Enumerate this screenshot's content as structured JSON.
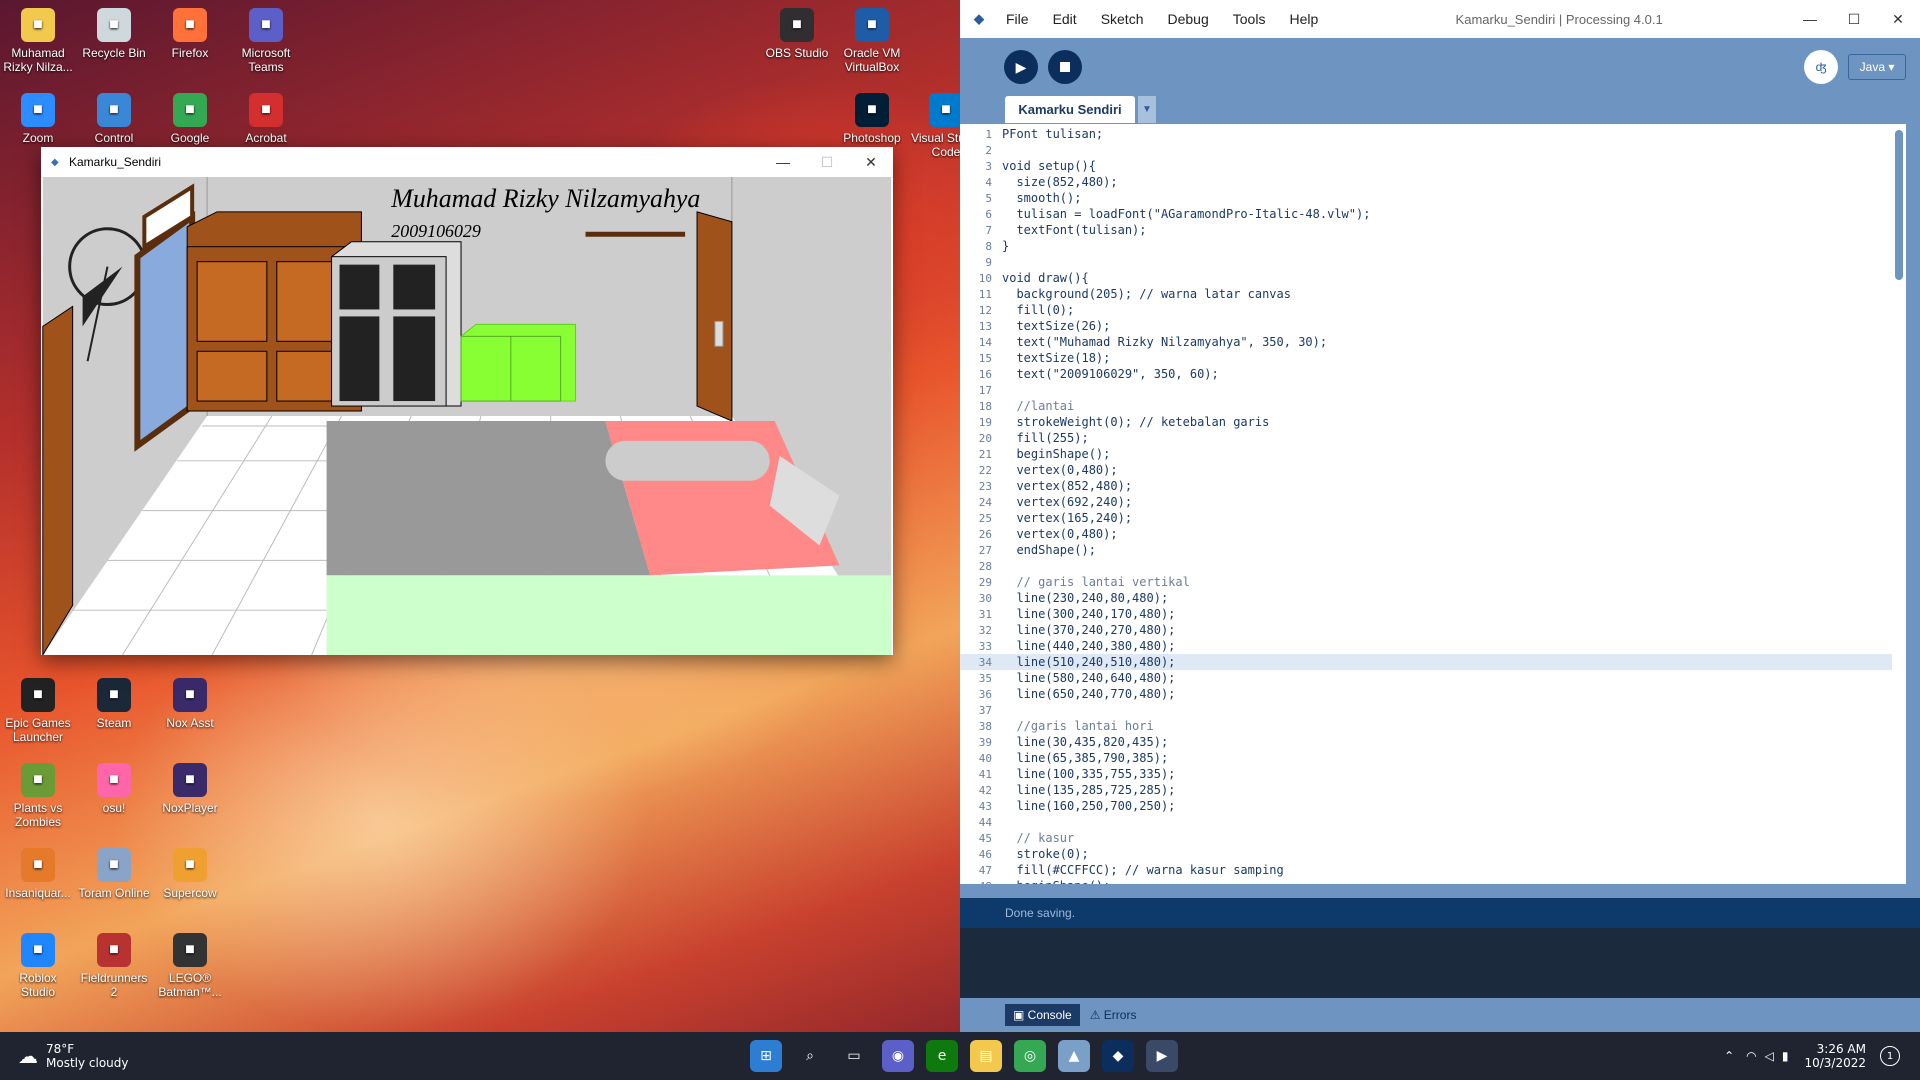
{
  "desktop": {
    "icons_left": [
      {
        "label": "Muhamad Rizky Nilza...",
        "color": "#f2c94c",
        "glyph": "folder-icon"
      },
      {
        "label": "Recycle Bin",
        "color": "#cfd8dc",
        "glyph": "recycle-icon"
      },
      {
        "label": "Firefox",
        "color": "#ff7139",
        "glyph": "firefox-icon"
      },
      {
        "label": "Microsoft Teams",
        "color": "#5b5fc7",
        "glyph": "teams-icon"
      },
      {
        "label": "Zoom",
        "color": "#2d8cff",
        "glyph": "zoom-icon"
      },
      {
        "label": "Control Panel",
        "color": "#3a87d8",
        "glyph": "control-panel-icon"
      },
      {
        "label": "Google",
        "color": "#34a853",
        "glyph": "chrome-icon"
      },
      {
        "label": "Acrobat",
        "color": "#d32f2f",
        "glyph": "acrobat-icon"
      },
      {
        "label": "Epic Games Launcher",
        "color": "#222222",
        "glyph": "epic-icon"
      },
      {
        "label": "Steam",
        "color": "#1b2838",
        "glyph": "steam-icon"
      },
      {
        "label": "Nox Asst",
        "color": "#3b2a6a",
        "glyph": "nox-icon"
      },
      {
        "label": "Plants vs Zombies",
        "color": "#6b9b37",
        "glyph": "pvz-icon"
      },
      {
        "label": "osu!",
        "color": "#ff66aa",
        "glyph": "osu-icon"
      },
      {
        "label": "NoxPlayer",
        "color": "#3b2a6a",
        "glyph": "noxplayer-icon"
      },
      {
        "label": "Insaniquar...",
        "color": "#e57a2a",
        "glyph": "insaniquarium-icon"
      },
      {
        "label": "Toram Online",
        "color": "#8aa4c8",
        "glyph": "toram-icon"
      },
      {
        "label": "Supercow",
        "color": "#f0a030",
        "glyph": "supercow-icon"
      },
      {
        "label": "Roblox Studio",
        "color": "#1f86ff",
        "glyph": "roblox-icon"
      },
      {
        "label": "Fieldrunners 2",
        "color": "#b83232",
        "glyph": "fieldrunners-icon"
      },
      {
        "label": "LEGO® Batman™...",
        "color": "#333333",
        "glyph": "lego-icon"
      }
    ],
    "icons_right": [
      {
        "label": "OBS Studio",
        "color": "#302e31",
        "glyph": "obs-icon"
      },
      {
        "label": "Oracle VM VirtualBox",
        "color": "#1f5ca8",
        "glyph": "virtualbox-icon"
      },
      {
        "label": "Photoshop",
        "color": "#001e36",
        "glyph": "photoshop-icon"
      },
      {
        "label": "Visual Studio Code",
        "color": "#007acc",
        "glyph": "vscode-icon"
      }
    ]
  },
  "sketch_window": {
    "title": "Kamarku_Sendiri",
    "name_text": "Muhamad Rizky Nilzamyahya",
    "id_text": "2009106029",
    "controls": {
      "minimize": "—",
      "maximize": "☐",
      "close": "✕"
    }
  },
  "ide": {
    "menu": [
      "File",
      "Edit",
      "Sketch",
      "Debug",
      "Tools",
      "Help"
    ],
    "title": "Kamarku_Sendiri | Processing 4.0.1",
    "mode": "Java ▾",
    "tab": "Kamarku Sendiri",
    "status": "Done saving.",
    "console_tab": "Console",
    "errors_tab": "Errors",
    "highlight_line": 34,
    "code": [
      "PFont tulisan;",
      "",
      "void setup(){",
      "  size(852,480);",
      "  smooth();",
      "  tulisan = loadFont(\"AGaramondPro-Italic-48.vlw\");",
      "  textFont(tulisan);",
      "}",
      "",
      "void draw(){",
      "  background(205); // warna latar canvas",
      "  fill(0);",
      "  textSize(26);",
      "  text(\"Muhamad Rizky Nilzamyahya\", 350, 30);",
      "  textSize(18);",
      "  text(\"2009106029\", 350, 60);",
      "",
      "  //lantai",
      "  strokeWeight(0); // ketebalan garis",
      "  fill(255);",
      "  beginShape();",
      "  vertex(0,480);",
      "  vertex(852,480);",
      "  vertex(692,240);",
      "  vertex(165,240);",
      "  vertex(0,480);",
      "  endShape();",
      "",
      "  // garis lantai vertikal",
      "  line(230,240,80,480);",
      "  line(300,240,170,480);",
      "  line(370,240,270,480);",
      "  line(440,240,380,480);",
      "  line(510,240,510,480);",
      "  line(580,240,640,480);",
      "  line(650,240,770,480);",
      "",
      "  //garis lantai hori",
      "  line(30,435,820,435);",
      "  line(65,385,790,385);",
      "  line(100,335,755,335);",
      "  line(135,285,725,285);",
      "  line(160,250,700,250);",
      "",
      "  // kasur",
      "  stroke(0);",
      "  fill(#CCFFCC); // warna kasur samping",
      "  beginShape();"
    ]
  },
  "taskbar": {
    "weather_temp": "78°F",
    "weather_desc": "Mostly cloudy",
    "time": "3:26 AM",
    "date": "10/3/2022",
    "notification_count": "1"
  }
}
